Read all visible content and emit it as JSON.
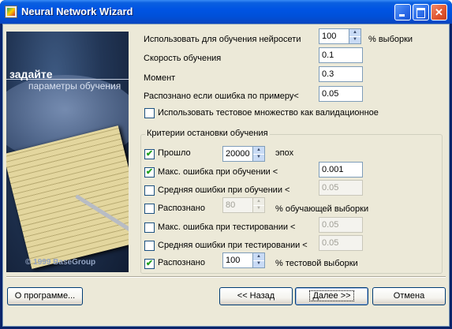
{
  "window": {
    "title": "Neural Network Wizard"
  },
  "picture": {
    "heading": "задайте",
    "subheading": "параметры обучения",
    "copyright": "© 1999 BaseGroup"
  },
  "params": {
    "use_for_training_label": "Использовать для обучения нейросети",
    "use_for_training_value": "100",
    "use_for_training_suffix": "% выборки",
    "learning_rate_label": "Скорость обучения",
    "learning_rate_value": "0.1",
    "momentum_label": "Момент",
    "momentum_value": "0.3",
    "recognized_error_label": "Распознано если ошибка по примеру<",
    "recognized_error_value": "0.05",
    "use_test_as_validation_label": "Использовать тестовое множество как валидационное",
    "use_test_as_validation_checked": false
  },
  "stop_criteria": {
    "title": "Критерии остановки обучения",
    "epochs": {
      "label": "Прошло",
      "value": "20000",
      "suffix": "эпох",
      "checked": true
    },
    "max_train_error": {
      "label": "Макс. ошибка при обучении <",
      "value": "0.001",
      "checked": true
    },
    "avg_train_error": {
      "label": "Средняя ошибки при обучении <",
      "value": "0.05",
      "checked": false
    },
    "recognized_train": {
      "label": "Распознано",
      "value": "80",
      "suffix": "% обучающей выборки",
      "checked": false
    },
    "max_test_error": {
      "label": "Макс. ошибка при тестировании <",
      "value": "0.05",
      "checked": false
    },
    "avg_test_error": {
      "label": "Средняя ошибки при тестировании <",
      "value": "0.05",
      "checked": false
    },
    "recognized_test": {
      "label": "Распознано",
      "value": "100",
      "suffix": "% тестовой выборки",
      "checked": true
    }
  },
  "buttons": {
    "about": "О программе...",
    "back": "<< Назад",
    "next": "Далее >>",
    "cancel": "Отмена"
  },
  "colors": {
    "titlebar": "#0054e3",
    "dialog_bg": "#ece9d8",
    "check": "#21a121"
  }
}
